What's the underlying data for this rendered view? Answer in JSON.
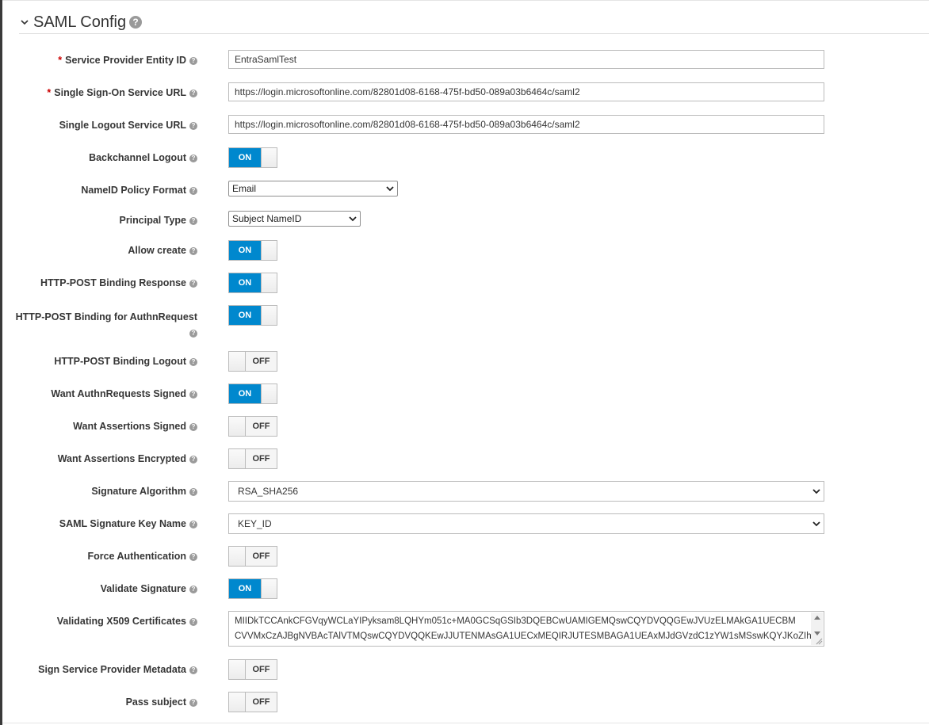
{
  "section": {
    "title": "SAML Config"
  },
  "fields": {
    "entity_id": {
      "label": "Service Provider Entity ID",
      "value": "EntraSamlTest",
      "required": true
    },
    "sso_url": {
      "label": "Single Sign-On Service URL",
      "value": "https://login.microsoftonline.com/82801d08-6168-475f-bd50-089a03b6464c/saml2",
      "required": true
    },
    "slo_url": {
      "label": "Single Logout Service URL",
      "value": "https://login.microsoftonline.com/82801d08-6168-475f-bd50-089a03b6464c/saml2"
    },
    "backchannel_logout": {
      "label": "Backchannel Logout",
      "state": "ON"
    },
    "nameid_policy": {
      "label": "NameID Policy Format",
      "value": "Email"
    },
    "principal_type": {
      "label": "Principal Type",
      "value": "Subject NameID"
    },
    "allow_create": {
      "label": "Allow create",
      "state": "ON"
    },
    "post_binding_response": {
      "label": "HTTP-POST Binding Response",
      "state": "ON"
    },
    "post_binding_authn": {
      "label": "HTTP-POST Binding for AuthnRequest",
      "state": "ON"
    },
    "post_binding_logout": {
      "label": "HTTP-POST Binding Logout",
      "state": "OFF"
    },
    "want_authn_signed": {
      "label": "Want AuthnRequests Signed",
      "state": "ON"
    },
    "want_assertions_signed": {
      "label": "Want Assertions Signed",
      "state": "OFF"
    },
    "want_assertions_encrypted": {
      "label": "Want Assertions Encrypted",
      "state": "OFF"
    },
    "signature_algorithm": {
      "label": "Signature Algorithm",
      "value": "RSA_SHA256"
    },
    "saml_key_name": {
      "label": "SAML Signature Key Name",
      "value": "KEY_ID"
    },
    "force_auth": {
      "label": "Force Authentication",
      "state": "OFF"
    },
    "validate_signature": {
      "label": "Validate Signature",
      "state": "ON"
    },
    "x509_certs": {
      "label": "Validating X509 Certificates",
      "line1": "MIIDkTCCAnkCFGVqyWCLaYIPyksam8LQHYm051c+MA0GCSqGSIb3DQEBCwUAMIGEMQswCQYDVQQGEwJVUzELMAkGA1UECBM",
      "line2": "CVVMxCzAJBgNVBAcTAlVTMQswCQYDVQQKEwJJUTENMAsGA1UECxMEQIRJUTESMBAGA1UEAxMJdGVzdC1zYW1sMSswKQYJKoZIh"
    },
    "sign_sp_metadata": {
      "label": "Sign Service Provider Metadata",
      "state": "OFF"
    },
    "pass_subject": {
      "label": "Pass subject",
      "state": "OFF"
    }
  },
  "colors": {
    "toggle_on": "#0088ce",
    "required": "#cc0000"
  },
  "icons": {
    "help": "question-circle-icon",
    "collapse": "chevron-down-icon"
  }
}
